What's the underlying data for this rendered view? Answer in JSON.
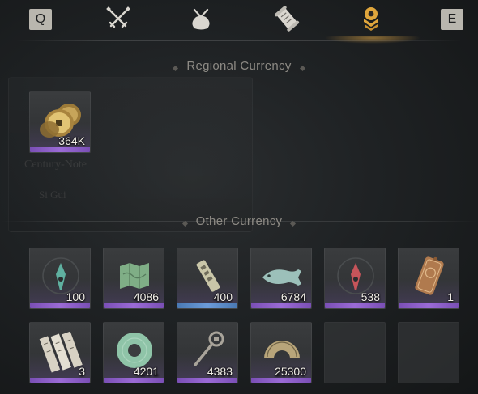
{
  "tabs": {
    "prev_key": "Q",
    "next_key": "E",
    "items": [
      {
        "icon": "crossed-swords-icon"
      },
      {
        "icon": "pouch-icon"
      },
      {
        "icon": "scroll-icon"
      },
      {
        "icon": "currency-icon",
        "active": true
      }
    ],
    "active_color": "#e0a63c"
  },
  "regional": {
    "title": "Regional Currency",
    "items": [
      {
        "icon": "coins-icon",
        "quantity": "364K"
      }
    ]
  },
  "other": {
    "title": "Other Currency",
    "items": [
      {
        "icon": "green-spirit-icon",
        "quantity": "100"
      },
      {
        "icon": "map-token-icon",
        "quantity": "4086"
      },
      {
        "icon": "jade-tablet-icon",
        "quantity": "400"
      },
      {
        "icon": "jade-fish-icon",
        "quantity": "6784"
      },
      {
        "icon": "red-spirit-icon",
        "quantity": "538"
      },
      {
        "icon": "bronze-plaque-icon",
        "quantity": "1"
      },
      {
        "icon": "paper-slips-icon",
        "quantity": "3"
      },
      {
        "icon": "jade-ring-icon",
        "quantity": "4201"
      },
      {
        "icon": "ancient-key-icon",
        "quantity": "4383"
      },
      {
        "icon": "half-disc-icon",
        "quantity": "25300"
      },
      {
        "icon": "empty-slot",
        "quantity": ""
      },
      {
        "icon": "empty-slot",
        "quantity": ""
      }
    ]
  }
}
